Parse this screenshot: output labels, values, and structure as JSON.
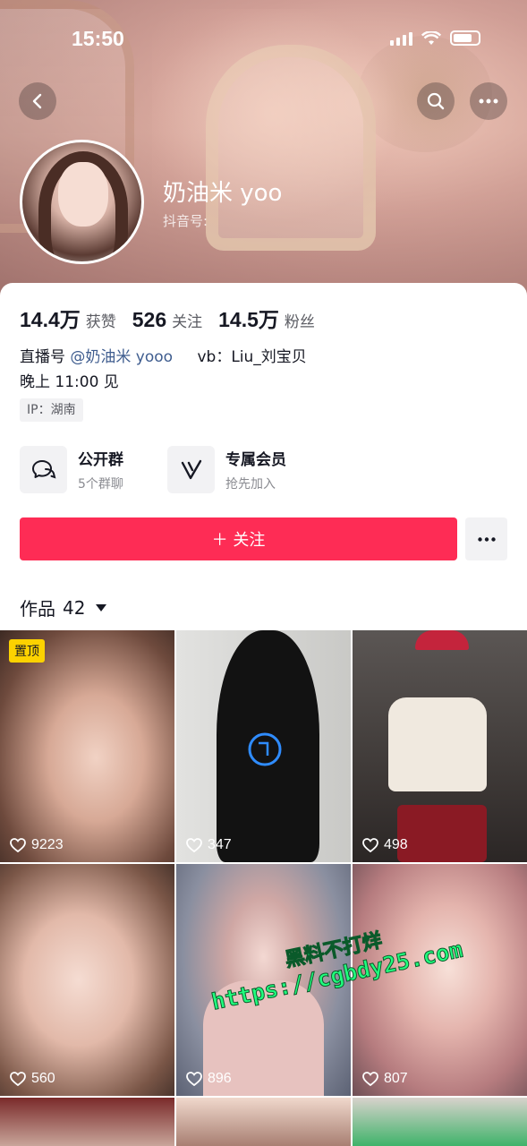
{
  "status_bar": {
    "time": "15:50"
  },
  "profile": {
    "nickname": "奶油米 yoo",
    "douyin_id_label": "抖音号:",
    "stats": [
      {
        "value": "14.4万",
        "label": "获赞"
      },
      {
        "value": "526",
        "label": "关注"
      },
      {
        "value": "14.5万",
        "label": "粉丝"
      }
    ],
    "bio": {
      "live_prefix": "直播号",
      "live_mention": "@奶油米 yooo",
      "vb": "vb：Liu_刘宝贝",
      "line2": "晚上 11:00 见"
    },
    "ip": "IP：湖南"
  },
  "features": {
    "group": {
      "title": "公开群",
      "subtitle": "5个群聊"
    },
    "vip": {
      "title": "专属会员",
      "subtitle": "抢先加入"
    }
  },
  "actions": {
    "follow_label": "＋ 关注"
  },
  "works": {
    "tab_label": "作品",
    "count": "42"
  },
  "videos": [
    {
      "likes": "9223",
      "pinned": "置顶"
    },
    {
      "likes": "347"
    },
    {
      "likes": "498"
    },
    {
      "likes": "560"
    },
    {
      "likes": "896"
    },
    {
      "likes": "807"
    }
  ],
  "watermark": {
    "line1": "黑料不打烊",
    "line2": "https://cgbdy25.com"
  },
  "colors": {
    "follow": "#fe2c55",
    "pin": "#fcd200",
    "mention": "#3f5d8f",
    "watermark": "#21ff7e"
  }
}
